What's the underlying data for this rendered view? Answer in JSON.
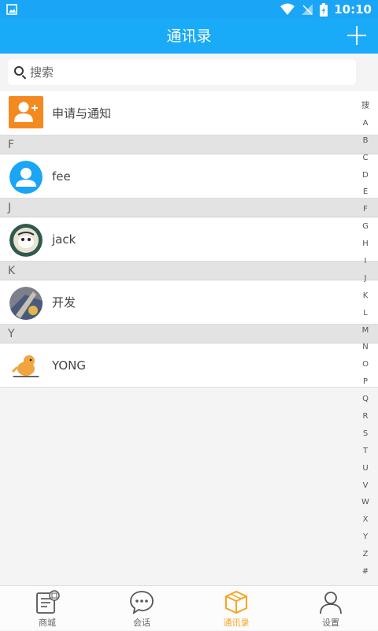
{
  "status": {
    "time": "10:10"
  },
  "appbar": {
    "title": "通讯录"
  },
  "search": {
    "placeholder": "搜索"
  },
  "notice_item": {
    "label": "申请与通知"
  },
  "sections": [
    {
      "letter": "F",
      "contacts": [
        {
          "name": "fee"
        }
      ]
    },
    {
      "letter": "J",
      "contacts": [
        {
          "name": "jack"
        }
      ]
    },
    {
      "letter": "K",
      "contacts": [
        {
          "name": "开发"
        }
      ]
    },
    {
      "letter": "Y",
      "contacts": [
        {
          "name": "YONG"
        }
      ]
    }
  ],
  "index_bar": [
    "搜",
    "A",
    "B",
    "C",
    "D",
    "E",
    "F",
    "G",
    "H",
    "I",
    "J",
    "K",
    "L",
    "M",
    "N",
    "O",
    "P",
    "Q",
    "R",
    "S",
    "T",
    "U",
    "V",
    "W",
    "X",
    "Y",
    "Z",
    "#"
  ],
  "tabs": [
    {
      "label": "商城",
      "icon": "store-icon"
    },
    {
      "label": "会话",
      "icon": "chat-icon"
    },
    {
      "label": "通讯录",
      "icon": "contacts-box-icon"
    },
    {
      "label": "设置",
      "icon": "person-icon"
    }
  ],
  "colors": {
    "primary": "#19aaf8",
    "accent": "#f6a51f",
    "notice": "#f48a1f"
  }
}
